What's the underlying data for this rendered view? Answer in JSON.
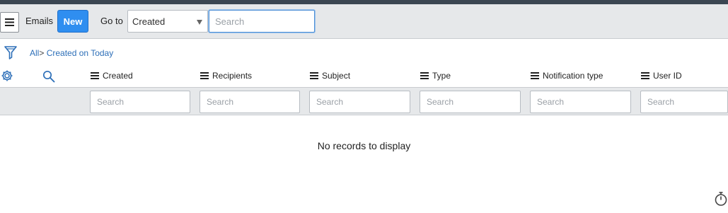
{
  "header": {
    "title": "Emails",
    "new_label": "New",
    "goto_label": "Go to",
    "goto_value": "Created",
    "search_placeholder": "Search"
  },
  "breadcrumb": {
    "root": "All",
    "separator": ">",
    "filter": "Created on Today"
  },
  "columns": [
    {
      "label": "Created",
      "search_placeholder": "Search"
    },
    {
      "label": "Recipients",
      "search_placeholder": "Search"
    },
    {
      "label": "Subject",
      "search_placeholder": "Search"
    },
    {
      "label": "Type",
      "search_placeholder": "Search"
    },
    {
      "label": "Notification type",
      "search_placeholder": "Search"
    },
    {
      "label": "User ID",
      "search_placeholder": "Search"
    }
  ],
  "list": {
    "empty_message": "No records to display"
  },
  "icons": {
    "menu": "hamburger-icon",
    "filter": "funnel-icon",
    "settings": "gear-icon",
    "search": "magnifier-icon",
    "response_time": "stopwatch-icon"
  },
  "colors": {
    "primary_button": "#2f8ef0",
    "link": "#2d6fb8",
    "toolbar_bg": "#e6e8ea"
  }
}
